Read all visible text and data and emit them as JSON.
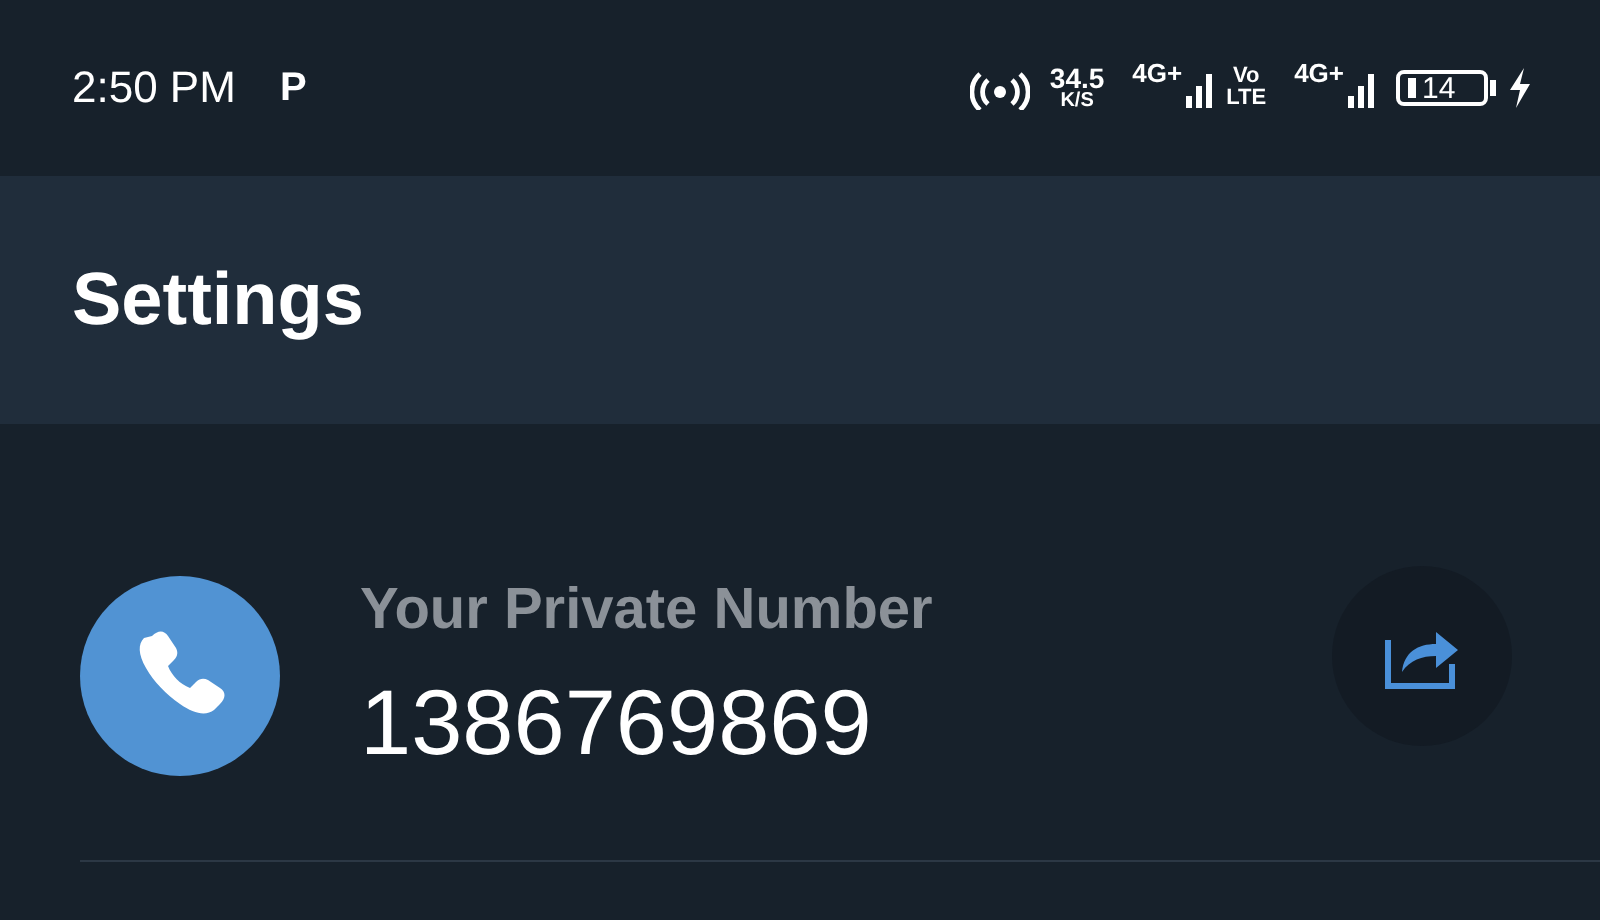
{
  "status_bar": {
    "time": "2:50 PM",
    "app_badge": "P",
    "speed_value": "34.5",
    "speed_unit": "K/S",
    "network_1": "4G+",
    "volte_top": "Vo",
    "volte_bottom": "LTE",
    "network_2": "4G+",
    "battery": "14",
    "charging": true
  },
  "header": {
    "title": "Settings"
  },
  "private_number": {
    "label": "Your Private Number",
    "number": "1386769869"
  }
}
